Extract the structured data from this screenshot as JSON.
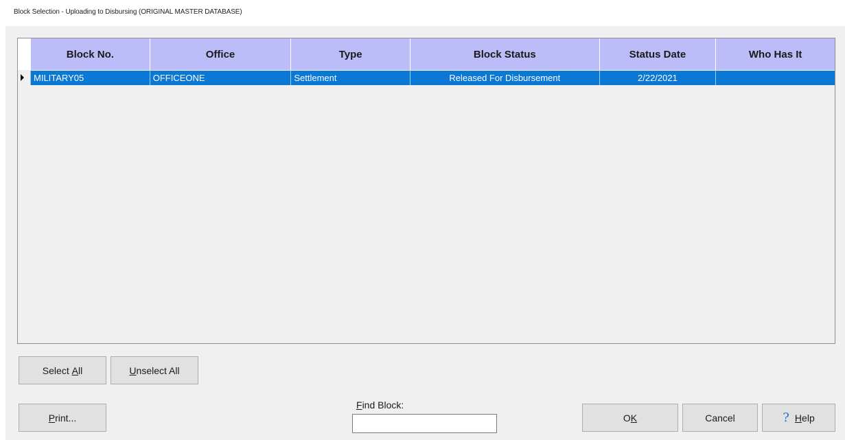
{
  "window": {
    "title": "Block Selection - Uploading to Disbursing (ORIGINAL MASTER DATABASE)"
  },
  "grid": {
    "columns": [
      "Block No.",
      "Office",
      "Type",
      "Block Status",
      "Status Date",
      "Who Has It"
    ],
    "rows": [
      {
        "block_no": "MILITARY05",
        "office": "OFFICEONE",
        "type": "Settlement",
        "block_status": "Released For Disbursement",
        "status_date": "2/22/2021",
        "who_has_it": ""
      }
    ]
  },
  "buttons": {
    "select_all": {
      "prefix": "Select ",
      "mnemonic": "A",
      "suffix": "ll"
    },
    "unselect_all": {
      "prefix": "",
      "mnemonic": "U",
      "suffix": "nselect All"
    },
    "print": {
      "prefix": "",
      "mnemonic": "P",
      "suffix": "rint..."
    },
    "ok": {
      "prefix": "O",
      "mnemonic": "K",
      "suffix": ""
    },
    "cancel": {
      "label": "Cancel"
    },
    "help": {
      "icon": "?",
      "prefix": "",
      "mnemonic": "H",
      "suffix": "elp"
    }
  },
  "find_block": {
    "label_mnemonic": "F",
    "label_rest": "ind Block:",
    "value": ""
  },
  "colors": {
    "header_bg": "#bcbcf8",
    "selected_row_bg": "#0a78d4",
    "dialog_bg": "#f0f0f0"
  }
}
